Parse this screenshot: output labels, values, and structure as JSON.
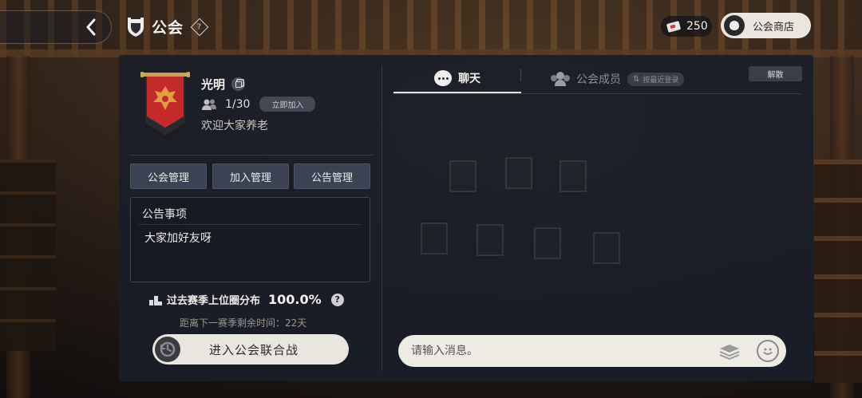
{
  "header": {
    "title": "公会",
    "help_symbol": "?",
    "currency_value": "250",
    "shop_label": "公会商店"
  },
  "guild": {
    "name": "光明",
    "members": "1/30",
    "join_mode": "立即加入",
    "motto": "欢迎大家养老"
  },
  "management": {
    "guild_mgmt": "公会管理",
    "join_mgmt": "加入管理",
    "notice_mgmt": "公告管理"
  },
  "notice": {
    "title": "公告事项",
    "body": "大家加好友呀"
  },
  "season": {
    "label": "过去赛季上位圈分布",
    "value": "100.0%",
    "help_symbol": "?",
    "countdown": "距离下一赛季剩余时间：22天"
  },
  "battle_button": "进入公会联合战",
  "tabs": {
    "chat": "聊天",
    "members": "公会成员",
    "sort": "按最近登录",
    "disband": "解散"
  },
  "chat_input": {
    "placeholder": "请输入消息。"
  },
  "colors": {
    "panel_bg": "#1a1e28",
    "banner_red": "#c42a2a",
    "button_bg": "#3a4254",
    "pill_light": "#e9e6df"
  },
  "icons": [
    "back-arrow-icon",
    "guild-shield-icon",
    "help-icon",
    "ticket-icon",
    "shop-bag-icon",
    "guild-banner-icon",
    "copy-icon",
    "members-icon",
    "podium-icon",
    "clock-icon",
    "chat-bubble-icon",
    "sort-icon",
    "stack-icon",
    "emoji-icon"
  ]
}
